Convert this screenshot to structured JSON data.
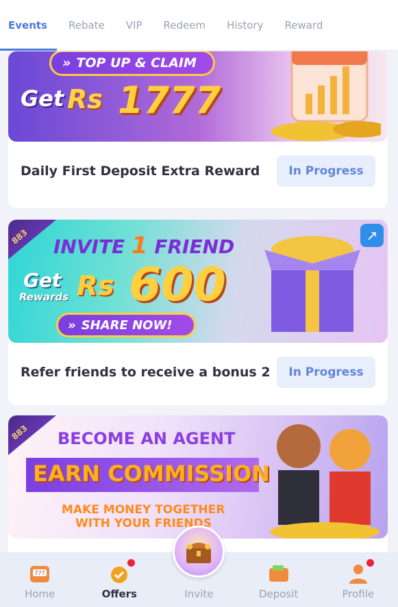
{
  "tabs": [
    "Events",
    "Rebate",
    "VIP",
    "Redeem",
    "History",
    "Reward"
  ],
  "cards": [
    {
      "banner_pill": "TOP UP & CLAIM",
      "banner_get": "Get",
      "banner_currency": "Rs",
      "banner_amount": "1777",
      "title": "Daily First Deposit Extra Reward",
      "status": "In Progress"
    },
    {
      "banner_badge": "883",
      "banner_headline_a": "INVITE",
      "banner_headline_num": "1",
      "banner_headline_b": "FRIEND",
      "banner_get": "Get",
      "banner_rewards": "Rewards",
      "banner_currency": "Rs",
      "banner_amount": "600",
      "banner_pill": "SHARE NOW!",
      "title": "Refer friends to receive a bonus 2",
      "status": "In Progress"
    },
    {
      "banner_badge": "883",
      "banner_line1": "BECOME AN AGENT",
      "banner_line2": "EARN COMMISSION",
      "banner_line3": "MAKE MONEY TOGETHER",
      "banner_line4": "WITH YOUR FRIENDS"
    }
  ],
  "nav": [
    {
      "label": "Home",
      "icon": "slot-machine-icon"
    },
    {
      "label": "Offers",
      "icon": "medal-icon"
    },
    {
      "label": "Invite",
      "icon": "treasure-chest-icon"
    },
    {
      "label": "Deposit",
      "icon": "wallet-icon"
    },
    {
      "label": "Profile",
      "icon": "user-icon"
    }
  ],
  "colors": {
    "accent": "#4b78d9",
    "status_bg": "#e8eefb",
    "badge": "#e8233b"
  }
}
